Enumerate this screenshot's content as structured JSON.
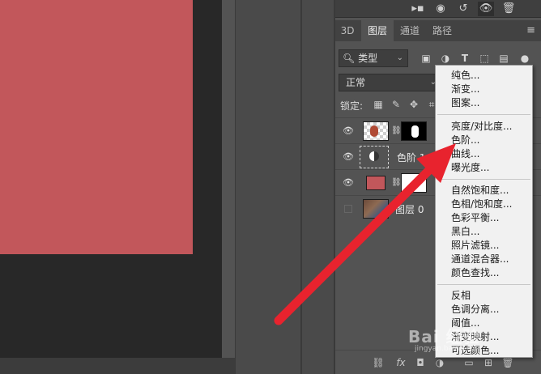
{
  "colors": {
    "canvas_bg": "#282828",
    "document": "#c2575b",
    "panel_bg": "#535353",
    "arrow": "#e8232e",
    "menu_bg": "#f1f1f1"
  },
  "toolbar_icons": [
    "cursor-icon",
    "visibility-toggle-icon",
    "history-icon",
    "eye-icon",
    "trash-icon"
  ],
  "tabs": [
    {
      "label": "3D"
    },
    {
      "label": "图层"
    },
    {
      "label": "通道"
    },
    {
      "label": "路径"
    }
  ],
  "filter": {
    "value": "类型",
    "icons": [
      "image-filter-icon",
      "adjustment-filter-icon",
      "type-filter-icon",
      "shape-filter-icon",
      "smart-object-filter-icon"
    ]
  },
  "blend_mode": "正常",
  "lock_label": "锁定:",
  "layers": [
    {
      "name": "",
      "visible": true,
      "type": "masked-pixel"
    },
    {
      "name": "色阶 1",
      "visible": true,
      "type": "adjustment"
    },
    {
      "name": "",
      "visible": true,
      "type": "color-fill"
    },
    {
      "name": "图层 0",
      "visible": false,
      "type": "pixel"
    }
  ],
  "bottom_icons": [
    "link-icon",
    "fx-icon",
    "mask-icon",
    "adjustment-icon",
    "folder-icon",
    "new-layer-icon",
    "trash-icon"
  ],
  "bottom_labels": {
    "fx": "fx"
  },
  "adjustment_menu": {
    "groups": [
      [
        "纯色...",
        "渐变...",
        "图案..."
      ],
      [
        "亮度/对比度...",
        "色阶...",
        "曲线...",
        "曝光度..."
      ],
      [
        "自然饱和度...",
        "色相/饱和度...",
        "色彩平衡...",
        "黑白...",
        "照片滤镜...",
        "通道混合器...",
        "颜色查找..."
      ],
      [
        "反相",
        "色调分离...",
        "阈值...",
        "渐变映射...",
        "可选颜色..."
      ]
    ]
  },
  "watermark": {
    "text": "Bai 经验",
    "sub": "jingyan.baidu.com"
  }
}
